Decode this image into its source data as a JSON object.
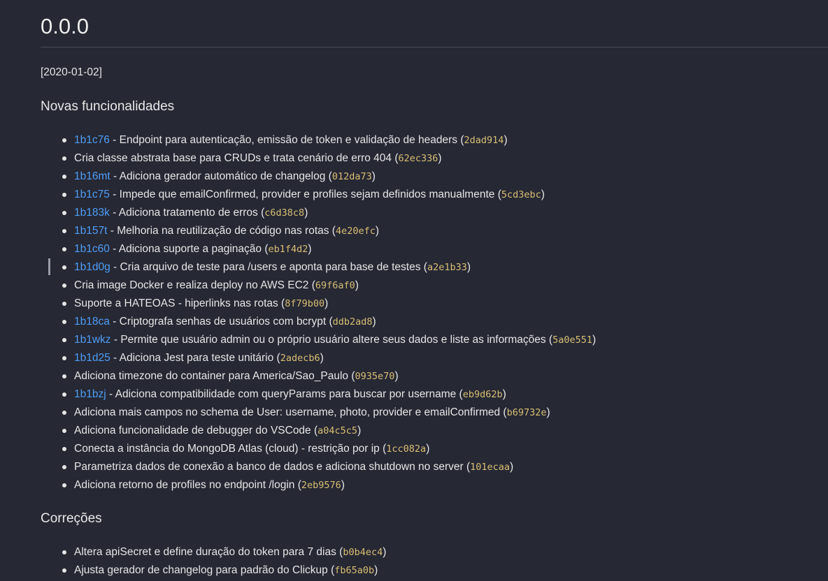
{
  "title": "0.0.0",
  "date": "[2020-01-02]",
  "sections": [
    {
      "heading": "Novas funcionalidades",
      "items": [
        {
          "task": "1b1c76",
          "sep": " - ",
          "text": "Endpoint para autenticação, emissão de token e validação de headers (",
          "hash": "2dad914",
          "close": ")"
        },
        {
          "task": "",
          "sep": "",
          "text": "Cria classe abstrata base para CRUDs e trata cenário de erro 404 (",
          "hash": "62ec336",
          "close": ")"
        },
        {
          "task": "1b16mt",
          "sep": " - ",
          "text": "Adiciona gerador automático de changelog (",
          "hash": "012da73",
          "close": ")"
        },
        {
          "task": "1b1c75",
          "sep": " - ",
          "text": "Impede que emailConfirmed, provider e profiles sejam definidos manualmente (",
          "hash": "5cd3ebc",
          "close": ")"
        },
        {
          "task": "1b183k",
          "sep": " - ",
          "text": "Adiciona tratamento de erros (",
          "hash": "c6d38c8",
          "close": ")"
        },
        {
          "task": "1b157t",
          "sep": " - ",
          "text": "Melhoria na reutilização de código nas rotas (",
          "hash": "4e20efc",
          "close": ")"
        },
        {
          "task": "1b1c60",
          "sep": " - ",
          "text": "Adiciona suporte a paginação (",
          "hash": "eb1f4d2",
          "close": ")"
        },
        {
          "task": "1b1d0g",
          "sep": " - ",
          "text": "Cria arquivo de teste para /users e aponta para base de testes (",
          "hash": "a2e1b33",
          "close": ")"
        },
        {
          "task": "",
          "sep": "",
          "text": "Cria image Docker e realiza deploy no AWS EC2 (",
          "hash": "69f6af0",
          "close": ")"
        },
        {
          "task": "",
          "sep": "",
          "text": "Suporte a HATEOAS - hiperlinks nas rotas (",
          "hash": "8f79b00",
          "close": ")"
        },
        {
          "task": "1b18ca",
          "sep": " - ",
          "text": "Criptografa senhas de usuários com bcrypt (",
          "hash": "ddb2ad8",
          "close": ")"
        },
        {
          "task": "1b1wkz",
          "sep": " - ",
          "text": "Permite que usuário admin ou o próprio usuário altere seus dados e liste as informações (",
          "hash": "5a0e551",
          "close": ")"
        },
        {
          "task": "1b1d25",
          "sep": " - ",
          "text": "Adiciona Jest para teste unitário (",
          "hash": "2adecb6",
          "close": ")"
        },
        {
          "task": "",
          "sep": "",
          "text": "Adiciona timezone do container para America/Sao_Paulo (",
          "hash": "0935e70",
          "close": ")"
        },
        {
          "task": "1b1bzj",
          "sep": " - ",
          "text": "Adiciona compatibilidade com queryParams para buscar por username (",
          "hash": "eb9d62b",
          "close": ")"
        },
        {
          "task": "",
          "sep": "",
          "text": "Adiciona mais campos no schema de User: username, photo, provider e emailConfirmed (",
          "hash": "b69732e",
          "close": ")"
        },
        {
          "task": "",
          "sep": "",
          "text": "Adiciona funcionalidade de debugger do VSCode (",
          "hash": "a04c5c5",
          "close": ")"
        },
        {
          "task": "",
          "sep": "",
          "text": "Conecta a instância do MongoDB Atlas (cloud) - restrição por ip (",
          "hash": "1cc082a",
          "close": ")"
        },
        {
          "task": "",
          "sep": "",
          "text": "Parametriza dados de conexão a banco de dados e adiciona shutdown no server (",
          "hash": "101ecaa",
          "close": ")"
        },
        {
          "task": "",
          "sep": "",
          "text": "Adiciona retorno de profiles no endpoint /login (",
          "hash": "2eb9576",
          "close": ")"
        }
      ]
    },
    {
      "heading": "Correções",
      "items": [
        {
          "task": "",
          "sep": "",
          "text": "Altera apiSecret e define duração do token para 7 dias (",
          "hash": "b0b4ec4",
          "close": ")"
        },
        {
          "task": "",
          "sep": "",
          "text": "Ajusta gerador de changelog para padrão do Clickup (",
          "hash": "fb65a0b",
          "close": ")"
        }
      ]
    }
  ],
  "colors": {
    "background": "#262834",
    "text": "#e6e6e6",
    "task_link": "#4f9ef5",
    "commit_hash": "#d9bf73"
  }
}
